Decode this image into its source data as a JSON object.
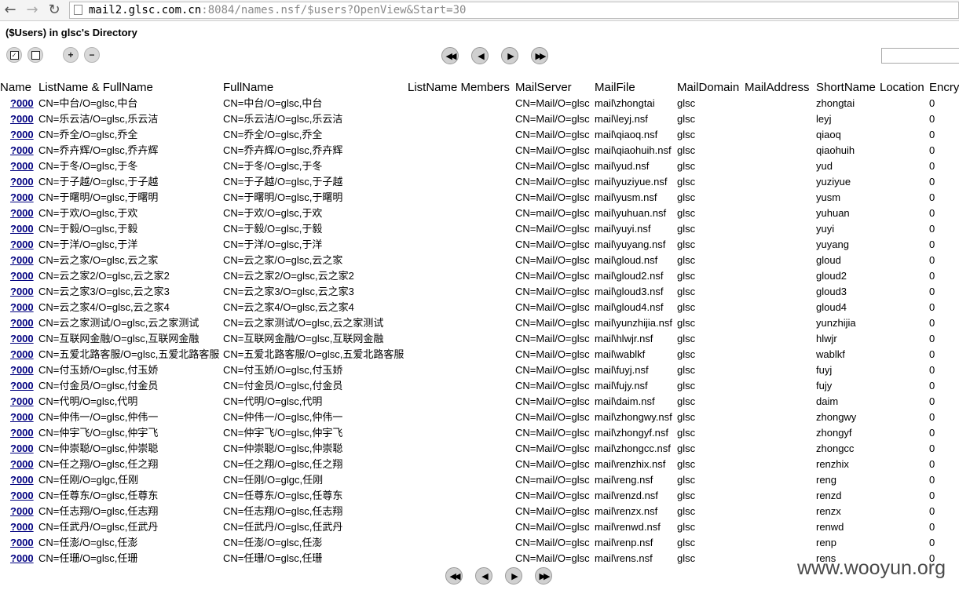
{
  "browser": {
    "url_host": "mail2.glsc.com.cn",
    "url_rest": ":8084/names.nsf/$users?OpenView&Start=30",
    "back_icon": "back-arrow-icon",
    "forward_icon": "forward-arrow-icon",
    "reload_icon": "reload-icon"
  },
  "page": {
    "title": "($Users) in glsc's Directory"
  },
  "toolbar": {
    "icons": [
      "select-all-icon",
      "deselect-all-icon",
      "expand-all-icon",
      "collapse-all-icon"
    ],
    "search_value": ""
  },
  "pager": {
    "first": "◀◀",
    "prev": "◀",
    "next": "▶",
    "last": "▶▶"
  },
  "table": {
    "headers": [
      "Name",
      "ListName & FullName",
      "FullName",
      "ListName Members",
      "MailServer",
      "MailFile",
      "MailDomain",
      "MailAddress",
      "ShortName",
      "Location",
      "Encry"
    ],
    "rows": [
      {
        "link": "?000",
        "listname": "CN=中台/O=glsc,中台",
        "fullname": "CN=中台/O=glsc,中台",
        "server": "CN=Mail/O=glsc",
        "file": "mail\\zhongtai",
        "domain": "glsc",
        "short": "zhongtai",
        "encry": "0"
      },
      {
        "link": "?000",
        "listname": "CN=乐云洁/O=glsc,乐云洁",
        "fullname": "CN=乐云洁/O=glsc,乐云洁",
        "server": "CN=Mail/O=glsc",
        "file": "mail\\leyj.nsf",
        "domain": "glsc",
        "short": "leyj",
        "encry": "0"
      },
      {
        "link": "?000",
        "listname": "CN=乔全/O=glsc,乔全",
        "fullname": "CN=乔全/O=glsc,乔全",
        "server": "CN=Mail/O=glsc",
        "file": "mail\\qiaoq.nsf",
        "domain": "glsc",
        "short": "qiaoq",
        "encry": "0"
      },
      {
        "link": "?000",
        "listname": "CN=乔卉辉/O=glsc,乔卉辉",
        "fullname": "CN=乔卉辉/O=glsc,乔卉辉",
        "server": "CN=Mail/O=glsc",
        "file": "mail\\qiaohuih.nsf",
        "domain": "glsc",
        "short": "qiaohuih",
        "encry": "0"
      },
      {
        "link": "?000",
        "listname": "CN=于冬/O=glsc,于冬",
        "fullname": "CN=于冬/O=glsc,于冬",
        "server": "CN=Mail/O=glsc",
        "file": "mail\\yud.nsf",
        "domain": "glsc",
        "short": "yud",
        "encry": "0"
      },
      {
        "link": "?000",
        "listname": "CN=于子越/O=glsc,于子越",
        "fullname": "CN=于子越/O=glsc,于子越",
        "server": "CN=Mail/O=glsc",
        "file": "mail\\yuziyue.nsf",
        "domain": "glsc",
        "short": "yuziyue",
        "encry": "0"
      },
      {
        "link": "?000",
        "listname": "CN=于曙明/O=glsc,于曙明",
        "fullname": "CN=于曙明/O=glsc,于曙明",
        "server": "CN=Mail/O=glsc",
        "file": "mail\\yusm.nsf",
        "domain": "glsc",
        "short": "yusm",
        "encry": "0"
      },
      {
        "link": "?000",
        "listname": "CN=于欢/O=glsc,于欢",
        "fullname": "CN=于欢/O=glsc,于欢",
        "server": "CN=mail/O=glsc",
        "file": "mail\\yuhuan.nsf",
        "domain": "glsc",
        "short": "yuhuan",
        "encry": "0"
      },
      {
        "link": "?000",
        "listname": "CN=于毅/O=glsc,于毅",
        "fullname": "CN=于毅/O=glsc,于毅",
        "server": "CN=Mail/O=glsc",
        "file": "mail\\yuyi.nsf",
        "domain": "glsc",
        "short": "yuyi",
        "encry": "0"
      },
      {
        "link": "?000",
        "listname": "CN=于洋/O=glsc,于洋",
        "fullname": "CN=于洋/O=glsc,于洋",
        "server": "CN=Mail/O=glsc",
        "file": "mail\\yuyang.nsf",
        "domain": "glsc",
        "short": "yuyang",
        "encry": "0"
      },
      {
        "link": "?000",
        "listname": "CN=云之家/O=glsc,云之家",
        "fullname": "CN=云之家/O=glsc,云之家",
        "server": "CN=Mail/O=glsc",
        "file": "mail\\gloud.nsf",
        "domain": "glsc",
        "short": "gloud",
        "encry": "0"
      },
      {
        "link": "?000",
        "listname": "CN=云之家2/O=glsc,云之家2",
        "fullname": "CN=云之家2/O=glsc,云之家2",
        "server": "CN=Mail/O=glsc",
        "file": "mail\\gloud2.nsf",
        "domain": "glsc",
        "short": "gloud2",
        "encry": "0"
      },
      {
        "link": "?000",
        "listname": "CN=云之家3/O=glsc,云之家3",
        "fullname": "CN=云之家3/O=glsc,云之家3",
        "server": "CN=Mail/O=glsc",
        "file": "mail\\gloud3.nsf",
        "domain": "glsc",
        "short": "gloud3",
        "encry": "0"
      },
      {
        "link": "?000",
        "listname": "CN=云之家4/O=glsc,云之家4",
        "fullname": "CN=云之家4/O=glsc,云之家4",
        "server": "CN=Mail/O=glsc",
        "file": "mail\\gloud4.nsf",
        "domain": "glsc",
        "short": "gloud4",
        "encry": "0"
      },
      {
        "link": "?000",
        "listname": "CN=云之家测试/O=glsc,云之家测试",
        "fullname": "CN=云之家测试/O=glsc,云之家测试",
        "server": "CN=Mail/O=glsc",
        "file": "mail\\yunzhijia.nsf",
        "domain": "glsc",
        "short": "yunzhijia",
        "encry": "0"
      },
      {
        "link": "?000",
        "listname": "CN=互联网金融/O=glsc,互联网金融",
        "fullname": "CN=互联网金融/O=glsc,互联网金融",
        "server": "CN=Mail/O=glsc",
        "file": "mail\\hlwjr.nsf",
        "domain": "glsc",
        "short": "hlwjr",
        "encry": "0"
      },
      {
        "link": "?000",
        "listname": "CN=五爱北路客服/O=glsc,五爱北路客服",
        "fullname": "CN=五爱北路客服/O=glsc,五爱北路客服",
        "server": "CN=Mail/O=glsc",
        "file": "mail\\wablkf",
        "domain": "glsc",
        "short": "wablkf",
        "encry": "0"
      },
      {
        "link": "?000",
        "listname": "CN=付玉娇/O=glsc,付玉娇",
        "fullname": "CN=付玉娇/O=glsc,付玉娇",
        "server": "CN=Mail/O=glsc",
        "file": "mail\\fuyj.nsf",
        "domain": "glsc",
        "short": "fuyj",
        "encry": "0"
      },
      {
        "link": "?000",
        "listname": "CN=付金员/O=glsc,付金员",
        "fullname": "CN=付金员/O=glsc,付金员",
        "server": "CN=Mail/O=glsc",
        "file": "mail\\fujy.nsf",
        "domain": "glsc",
        "short": "fujy",
        "encry": "0"
      },
      {
        "link": "?000",
        "listname": "CN=代明/O=glsc,代明",
        "fullname": "CN=代明/O=glsc,代明",
        "server": "CN=Mail/O=glsc",
        "file": "mail\\daim.nsf",
        "domain": "glsc",
        "short": "daim",
        "encry": "0"
      },
      {
        "link": "?000",
        "listname": "CN=仲伟一/O=glsc,仲伟一",
        "fullname": "CN=仲伟一/O=glsc,仲伟一",
        "server": "CN=Mail/O=glsc",
        "file": "mail\\zhongwy.nsf",
        "domain": "glsc",
        "short": "zhongwy",
        "encry": "0"
      },
      {
        "link": "?000",
        "listname": "CN=仲宇飞/O=glsc,仲宇飞",
        "fullname": "CN=仲宇飞/O=glsc,仲宇飞",
        "server": "CN=Mail/O=glsc",
        "file": "mail\\zhongyf.nsf",
        "domain": "glsc",
        "short": "zhongyf",
        "encry": "0"
      },
      {
        "link": "?000",
        "listname": "CN=仲崇聪/O=glsc,仲崇聪",
        "fullname": "CN=仲崇聪/O=glsc,仲崇聪",
        "server": "CN=Mail/O=glsc",
        "file": "mail\\zhongcc.nsf",
        "domain": "glsc",
        "short": "zhongcc",
        "encry": "0"
      },
      {
        "link": "?000",
        "listname": "CN=任之翔/O=glsc,任之翔",
        "fullname": "CN=任之翔/O=glsc,任之翔",
        "server": "CN=Mail/O=glsc",
        "file": "mail\\renzhix.nsf",
        "domain": "glsc",
        "short": "renzhix",
        "encry": "0"
      },
      {
        "link": "?000",
        "listname": "CN=任刚/O=glgc,任刚",
        "fullname": "CN=任刚/O=glgc,任刚",
        "server": "CN=mail/O=glsc",
        "file": "mail\\reng.nsf",
        "domain": "glsc",
        "short": "reng",
        "encry": "0"
      },
      {
        "link": "?000",
        "listname": "CN=任尊东/O=glsc,任尊东",
        "fullname": "CN=任尊东/O=glsc,任尊东",
        "server": "CN=Mail/O=glsc",
        "file": "mail\\renzd.nsf",
        "domain": "glsc",
        "short": "renzd",
        "encry": "0"
      },
      {
        "link": "?000",
        "listname": "CN=任志翔/O=glsc,任志翔",
        "fullname": "CN=任志翔/O=glsc,任志翔",
        "server": "CN=Mail/O=glsc",
        "file": "mail\\renzx.nsf",
        "domain": "glsc",
        "short": "renzx",
        "encry": "0"
      },
      {
        "link": "?000",
        "listname": "CN=任武丹/O=glsc,任武丹",
        "fullname": "CN=任武丹/O=glsc,任武丹",
        "server": "CN=Mail/O=glsc",
        "file": "mail\\renwd.nsf",
        "domain": "glsc",
        "short": "renwd",
        "encry": "0"
      },
      {
        "link": "?000",
        "listname": "CN=任澎/O=glsc,任澎",
        "fullname": "CN=任澎/O=glsc,任澎",
        "server": "CN=Mail/O=glsc",
        "file": "mail\\renp.nsf",
        "domain": "glsc",
        "short": "renp",
        "encry": "0"
      },
      {
        "link": "?000",
        "listname": "CN=任珊/O=glsc,任珊",
        "fullname": "CN=任珊/O=glsc,任珊",
        "server": "CN=Mail/O=glsc",
        "file": "mail\\rens.nsf",
        "domain": "glsc",
        "short": "rens",
        "encry": "0"
      }
    ]
  },
  "watermark": "www.wooyun.org"
}
